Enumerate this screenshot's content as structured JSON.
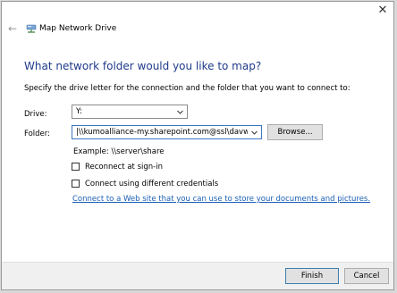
{
  "window": {
    "title": "Map Network Drive",
    "close_glyph": "✕",
    "back_glyph": "←"
  },
  "heading": "What network folder would you like to map?",
  "instructions": "Specify the drive letter for the connection and the folder that you want to connect to:",
  "drive": {
    "label": "Drive:",
    "value": "Y:"
  },
  "folder": {
    "label": "Folder:",
    "value": "|\\\\kumoalliance-my.sharepoint.com@ssl\\davwwwr",
    "browse_label": "Browse..."
  },
  "example": "Example: \\\\server\\share",
  "options": {
    "reconnect": {
      "label": "Reconnect at sign-in",
      "checked": false
    },
    "credentials": {
      "label": "Connect using different credentials",
      "checked": false
    }
  },
  "link_text": "Connect to a Web site that you can use to store your documents and pictures.",
  "buttons": {
    "finish": "Finish",
    "cancel": "Cancel"
  },
  "colors": {
    "heading": "#1e3a8a",
    "link": "#1a5fb4",
    "accent": "#3a78c2"
  },
  "icons": {
    "title": "network-drive-icon",
    "back": "back-arrow-icon",
    "close": "close-icon",
    "dropdown": "chevron-down-icon"
  }
}
